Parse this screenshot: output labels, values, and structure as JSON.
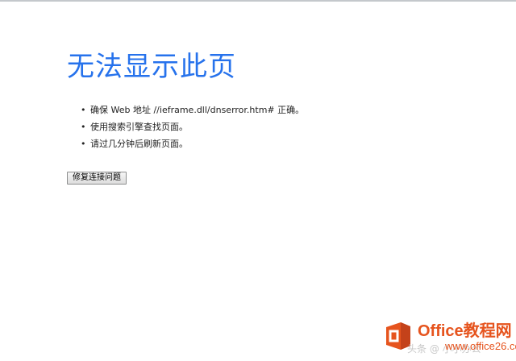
{
  "page": {
    "title": "无法显示此页",
    "suggestions": [
      "确保 Web 地址 //ieframe.dll/dnserror.htm# 正确。",
      "使用搜索引擎查找页面。",
      "请过几分钟后刷新页面。"
    ],
    "bullet_glyph": "•",
    "fix_button_label": "修复连接问题"
  },
  "watermark": {
    "brand": "Office教程网",
    "url": "www.office26.com",
    "faint_text": "头条 @ 小小办公"
  },
  "colors": {
    "title": "#2672ec",
    "watermark_orange": "#e6541e",
    "window_border": "#c4c8cc"
  },
  "icons": {
    "watermark_logo": "office-logo-icon"
  }
}
